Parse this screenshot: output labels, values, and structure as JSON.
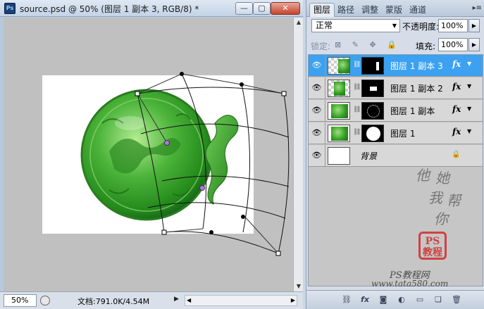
{
  "window": {
    "title": "source.psd @ 50% (图层 1 副本 3, RGB/8) *",
    "app_icon": "Ps",
    "buttons": {
      "minimize": "—",
      "maximize": "▢",
      "close": "✕"
    }
  },
  "status": {
    "zoom": "50%",
    "doc_info": "文档:791.0K/4.54M",
    "arrow": "▶"
  },
  "panel": {
    "tabs": [
      {
        "label": "图层",
        "active": true
      },
      {
        "label": "路径",
        "active": false
      },
      {
        "label": "调整",
        "active": false
      },
      {
        "label": "蒙版",
        "active": false
      },
      {
        "label": "通道",
        "active": false
      }
    ],
    "tab_menu": "▸≡",
    "blend_mode": "正常",
    "opacity_label": "不透明度:",
    "opacity": "100%",
    "lock_label": "锁定:",
    "lock_icons": "⊠ ✎ ✥ 🔒",
    "fill_label": "填充:",
    "fill": "100%",
    "layers": [
      {
        "name": "图层 1 副本 3",
        "selected": true,
        "fx": "fx"
      },
      {
        "name": "图层 1 副本 2",
        "selected": false,
        "fx": "fx"
      },
      {
        "name": "图层 1 副本",
        "selected": false,
        "fx": "fx"
      },
      {
        "name": "图层 1",
        "selected": false,
        "fx": "fx"
      }
    ],
    "background_layer": {
      "name": "背景"
    },
    "watermark": {
      "handwriting": [
        "他",
        "她",
        "我",
        "帮",
        "你"
      ],
      "seal": "PS\n教程",
      "site_line1": "PS教程网",
      "site_line2": "www.tata580.com"
    },
    "footer_icons": [
      "link-icon",
      "fx-icon",
      "mask-icon",
      "adjustment-icon",
      "group-icon",
      "new-layer-icon",
      "trash-icon"
    ]
  },
  "colors": {
    "selection": "#3ba1f0",
    "jade_green": "#2f9a22",
    "seal_red": "#d22b2b"
  }
}
